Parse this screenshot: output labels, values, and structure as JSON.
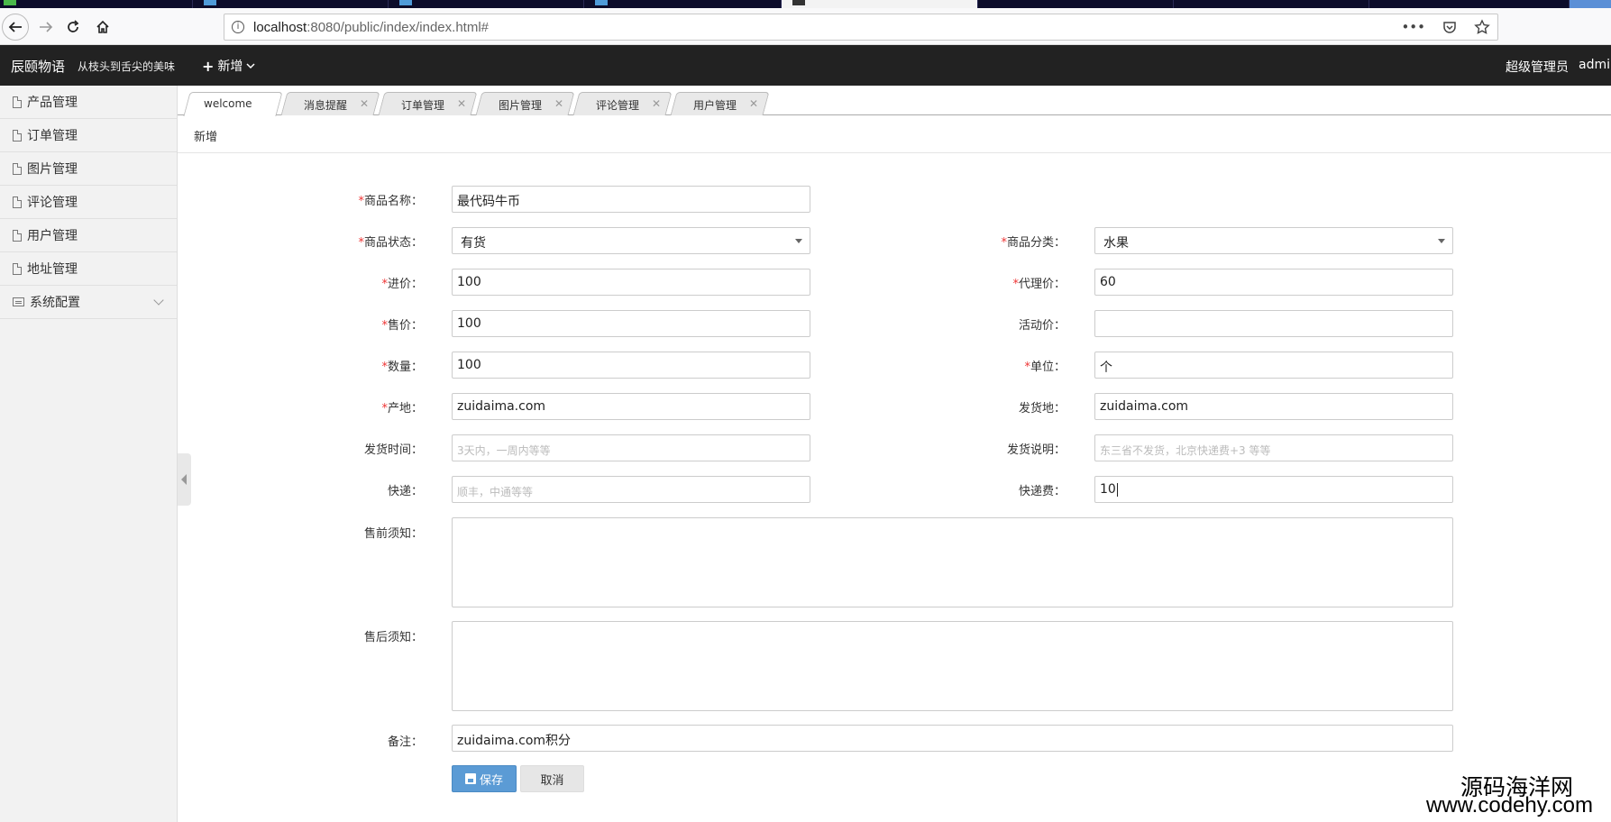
{
  "browser": {
    "url_host": "localhost",
    "url_rest": ":8080/public/index/index.html#",
    "more_icon": "•••"
  },
  "app": {
    "brand": "辰颐物语",
    "slogan": "从枝头到舌尖的美味",
    "add_menu": "新增",
    "admin_role": "超级管理员",
    "admin_name": "admin"
  },
  "sidebar": {
    "items": [
      {
        "label": "产品管理"
      },
      {
        "label": "订单管理"
      },
      {
        "label": "图片管理"
      },
      {
        "label": "评论管理"
      },
      {
        "label": "用户管理"
      },
      {
        "label": "地址管理"
      },
      {
        "label": "系统配置"
      }
    ]
  },
  "tabs": [
    {
      "label": "welcome"
    },
    {
      "label": "消息提醒"
    },
    {
      "label": "订单管理"
    },
    {
      "label": "图片管理"
    },
    {
      "label": "评论管理"
    },
    {
      "label": "用户管理"
    }
  ],
  "breadcrumb": "新增",
  "form": {
    "name_label": "商品名称：",
    "name_value": "最代码牛币",
    "status_label": "商品状态：",
    "status_value": "有货",
    "category_label": "商品分类：",
    "category_value": "水果",
    "cost_label": "进价：",
    "cost_value": "100",
    "agent_price_label": "代理价：",
    "agent_price_value": "60",
    "sale_price_label": "售价：",
    "sale_price_value": "100",
    "promo_price_label": "活动价：",
    "promo_price_value": "",
    "quantity_label": "数量：",
    "quantity_value": "100",
    "unit_label": "单位：",
    "unit_value": "个",
    "origin_label": "产地：",
    "origin_value": "zuidaima.com",
    "ship_from_label": "发货地：",
    "ship_from_value": "zuidaima.com",
    "ship_time_label": "发货时间：",
    "ship_time_placeholder": "3天内，一周内等等",
    "ship_note_label": "发货说明：",
    "ship_note_placeholder": "东三省不发货，北京快递费+3 等等",
    "courier_label": "快递：",
    "courier_placeholder": "顺丰，中通等等",
    "courier_fee_label": "快递费：",
    "courier_fee_value": "10",
    "presale_label": "售前须知：",
    "aftersale_label": "售后须知：",
    "remark_label": "备注：",
    "remark_value": "zuidaima.com积分",
    "required_mark": "*",
    "save_label": "保存",
    "cancel_label": "取消"
  },
  "watermark": {
    "line1": "源码海洋网",
    "line2": "www.codehy.com"
  }
}
